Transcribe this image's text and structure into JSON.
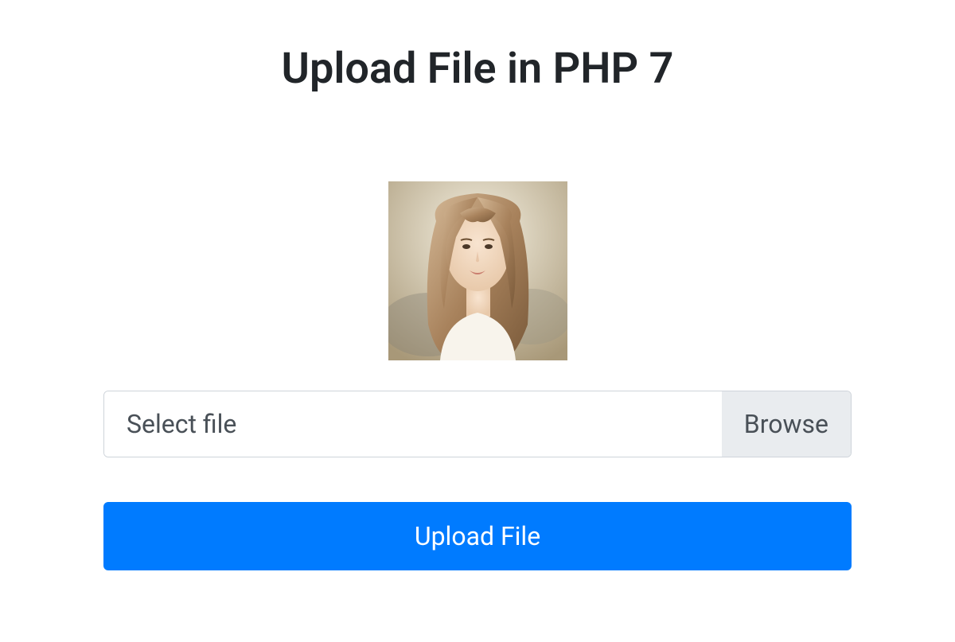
{
  "title": "Upload File in PHP 7",
  "file_input": {
    "placeholder": "Select file",
    "browse_label": "Browse"
  },
  "upload_button_label": "Upload File",
  "colors": {
    "primary": "#007bff",
    "border": "#ced4da",
    "muted_bg": "#e9ecef",
    "text": "#495057",
    "heading": "#212529"
  }
}
